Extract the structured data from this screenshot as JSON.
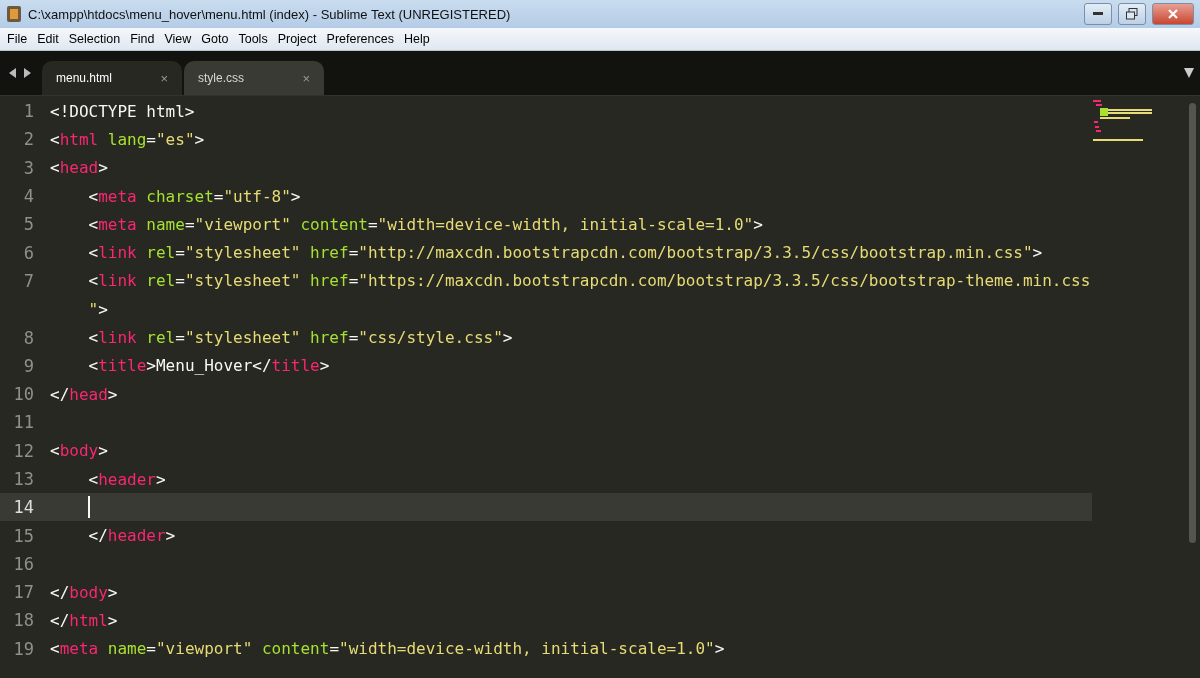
{
  "window": {
    "title": "C:\\xampp\\htdocs\\menu_hover\\menu.html (index) - Sublime Text (UNREGISTERED)"
  },
  "menu": [
    "File",
    "Edit",
    "Selection",
    "Find",
    "View",
    "Goto",
    "Tools",
    "Project",
    "Preferences",
    "Help"
  ],
  "tabs": [
    {
      "label": "menu.html",
      "close": "×",
      "selected": true
    },
    {
      "label": "style.css",
      "close": "×",
      "selected": false
    }
  ],
  "lines": [
    {
      "number": "1",
      "current": false,
      "tokens": [
        {
          "kind": "punct",
          "text": "<!DOCTYPE html>"
        }
      ]
    },
    {
      "number": "2",
      "current": false,
      "tokens": [
        {
          "kind": "punct",
          "text": "<"
        },
        {
          "kind": "tag",
          "text": "html"
        },
        {
          "kind": "attr",
          "text": " lang"
        },
        {
          "kind": "punct",
          "text": "="
        },
        {
          "kind": "string",
          "text": "\"es\""
        },
        {
          "kind": "punct",
          "text": ">"
        }
      ]
    },
    {
      "number": "3",
      "current": false,
      "tokens": [
        {
          "kind": "punct",
          "text": "<"
        },
        {
          "kind": "tag",
          "text": "head"
        },
        {
          "kind": "punct",
          "text": ">"
        }
      ]
    },
    {
      "number": "4",
      "current": false,
      "tokens": [
        {
          "kind": "punct",
          "text": "    <"
        },
        {
          "kind": "tag",
          "text": "meta"
        },
        {
          "kind": "attr",
          "text": " charset"
        },
        {
          "kind": "punct",
          "text": "="
        },
        {
          "kind": "string",
          "text": "\"utf-8\""
        },
        {
          "kind": "punct",
          "text": ">"
        }
      ]
    },
    {
      "number": "5",
      "current": false,
      "tokens": [
        {
          "kind": "punct",
          "text": "    <"
        },
        {
          "kind": "tag",
          "text": "meta"
        },
        {
          "kind": "attr",
          "text": " name"
        },
        {
          "kind": "punct",
          "text": "="
        },
        {
          "kind": "string",
          "text": "\"viewport\""
        },
        {
          "kind": "attr",
          "text": " content"
        },
        {
          "kind": "punct",
          "text": "="
        },
        {
          "kind": "string",
          "text": "\"width=device-width, initial-scale=1.0\""
        },
        {
          "kind": "punct",
          "text": ">"
        }
      ]
    },
    {
      "number": "6",
      "current": false,
      "tokens": [
        {
          "kind": "punct",
          "text": "    <"
        },
        {
          "kind": "tag",
          "text": "link"
        },
        {
          "kind": "attr",
          "text": " rel"
        },
        {
          "kind": "punct",
          "text": "="
        },
        {
          "kind": "string",
          "text": "\"stylesheet\""
        },
        {
          "kind": "attr",
          "text": " href"
        },
        {
          "kind": "punct",
          "text": "="
        },
        {
          "kind": "string",
          "text": "\"http://maxcdn.bootstrapcdn.com/bootstrap/3.3.5/css/bootstrap.min.css\""
        },
        {
          "kind": "punct",
          "text": ">"
        }
      ]
    },
    {
      "number": "7",
      "current": false,
      "tokens": [
        {
          "kind": "punct",
          "text": "    <"
        },
        {
          "kind": "tag",
          "text": "link"
        },
        {
          "kind": "attr",
          "text": " rel"
        },
        {
          "kind": "punct",
          "text": "="
        },
        {
          "kind": "string",
          "text": "\"stylesheet\""
        },
        {
          "kind": "attr",
          "text": " href"
        },
        {
          "kind": "punct",
          "text": "="
        },
        {
          "kind": "string",
          "text": "\"https://maxcdn.bootstrapcdn.com/bootstrap/3.3.5/css/bootstrap-theme.min.css"
        }
      ]
    },
    {
      "current": false,
      "tokens": [
        {
          "kind": "string",
          "text": "    \""
        },
        {
          "kind": "punct",
          "text": ">"
        }
      ]
    },
    {
      "number": "8",
      "current": false,
      "tokens": [
        {
          "kind": "punct",
          "text": "    <"
        },
        {
          "kind": "tag",
          "text": "link"
        },
        {
          "kind": "attr",
          "text": " rel"
        },
        {
          "kind": "punct",
          "text": "="
        },
        {
          "kind": "string",
          "text": "\"stylesheet\""
        },
        {
          "kind": "attr",
          "text": " href"
        },
        {
          "kind": "punct",
          "text": "="
        },
        {
          "kind": "string",
          "text": "\"css/style.css\""
        },
        {
          "kind": "punct",
          "text": ">"
        }
      ]
    },
    {
      "number": "9",
      "current": false,
      "tokens": [
        {
          "kind": "punct",
          "text": "    <"
        },
        {
          "kind": "tag",
          "text": "title"
        },
        {
          "kind": "punct",
          "text": ">Menu_Hover</"
        },
        {
          "kind": "tag",
          "text": "title"
        },
        {
          "kind": "punct",
          "text": ">"
        }
      ]
    },
    {
      "number": "10",
      "current": false,
      "tokens": [
        {
          "kind": "punct",
          "text": "</"
        },
        {
          "kind": "tag",
          "text": "head"
        },
        {
          "kind": "punct",
          "text": ">"
        }
      ]
    },
    {
      "number": "11",
      "current": false
    },
    {
      "number": "12",
      "current": false,
      "tokens": [
        {
          "kind": "punct",
          "text": "<"
        },
        {
          "kind": "tag",
          "text": "body"
        },
        {
          "kind": "punct",
          "text": ">"
        }
      ]
    },
    {
      "number": "13",
      "current": false,
      "tokens": [
        {
          "kind": "punct",
          "text": "    <"
        },
        {
          "kind": "tag",
          "text": "header"
        },
        {
          "kind": "punct",
          "text": ">"
        }
      ]
    },
    {
      "number": "14",
      "current": true
    },
    {
      "number": "15",
      "current": false,
      "tokens": [
        {
          "kind": "punct",
          "text": "    </"
        },
        {
          "kind": "tag",
          "text": "header"
        },
        {
          "kind": "punct",
          "text": ">"
        }
      ]
    },
    {
      "number": "16",
      "current": false
    },
    {
      "number": "17",
      "current": false,
      "tokens": [
        {
          "kind": "punct",
          "text": "</"
        },
        {
          "kind": "tag",
          "text": "body"
        },
        {
          "kind": "punct",
          "text": ">"
        }
      ]
    },
    {
      "number": "18",
      "current": false,
      "tokens": [
        {
          "kind": "punct",
          "text": "</"
        },
        {
          "kind": "tag",
          "text": "html"
        },
        {
          "kind": "punct",
          "text": ">"
        }
      ]
    },
    {
      "number": "19",
      "current": false,
      "tokens": [
        {
          "kind": "punct",
          "text": "<"
        },
        {
          "kind": "tag",
          "text": "meta"
        },
        {
          "kind": "attr",
          "text": " name"
        },
        {
          "kind": "punct",
          "text": "="
        },
        {
          "kind": "string",
          "text": "\"viewport\""
        },
        {
          "kind": "attr",
          "text": " content"
        },
        {
          "kind": "punct",
          "text": "="
        },
        {
          "kind": "string",
          "text": "\"width=device-width, initial-scale=1.0\""
        },
        {
          "kind": "punct",
          "text": ">"
        }
      ]
    }
  ]
}
